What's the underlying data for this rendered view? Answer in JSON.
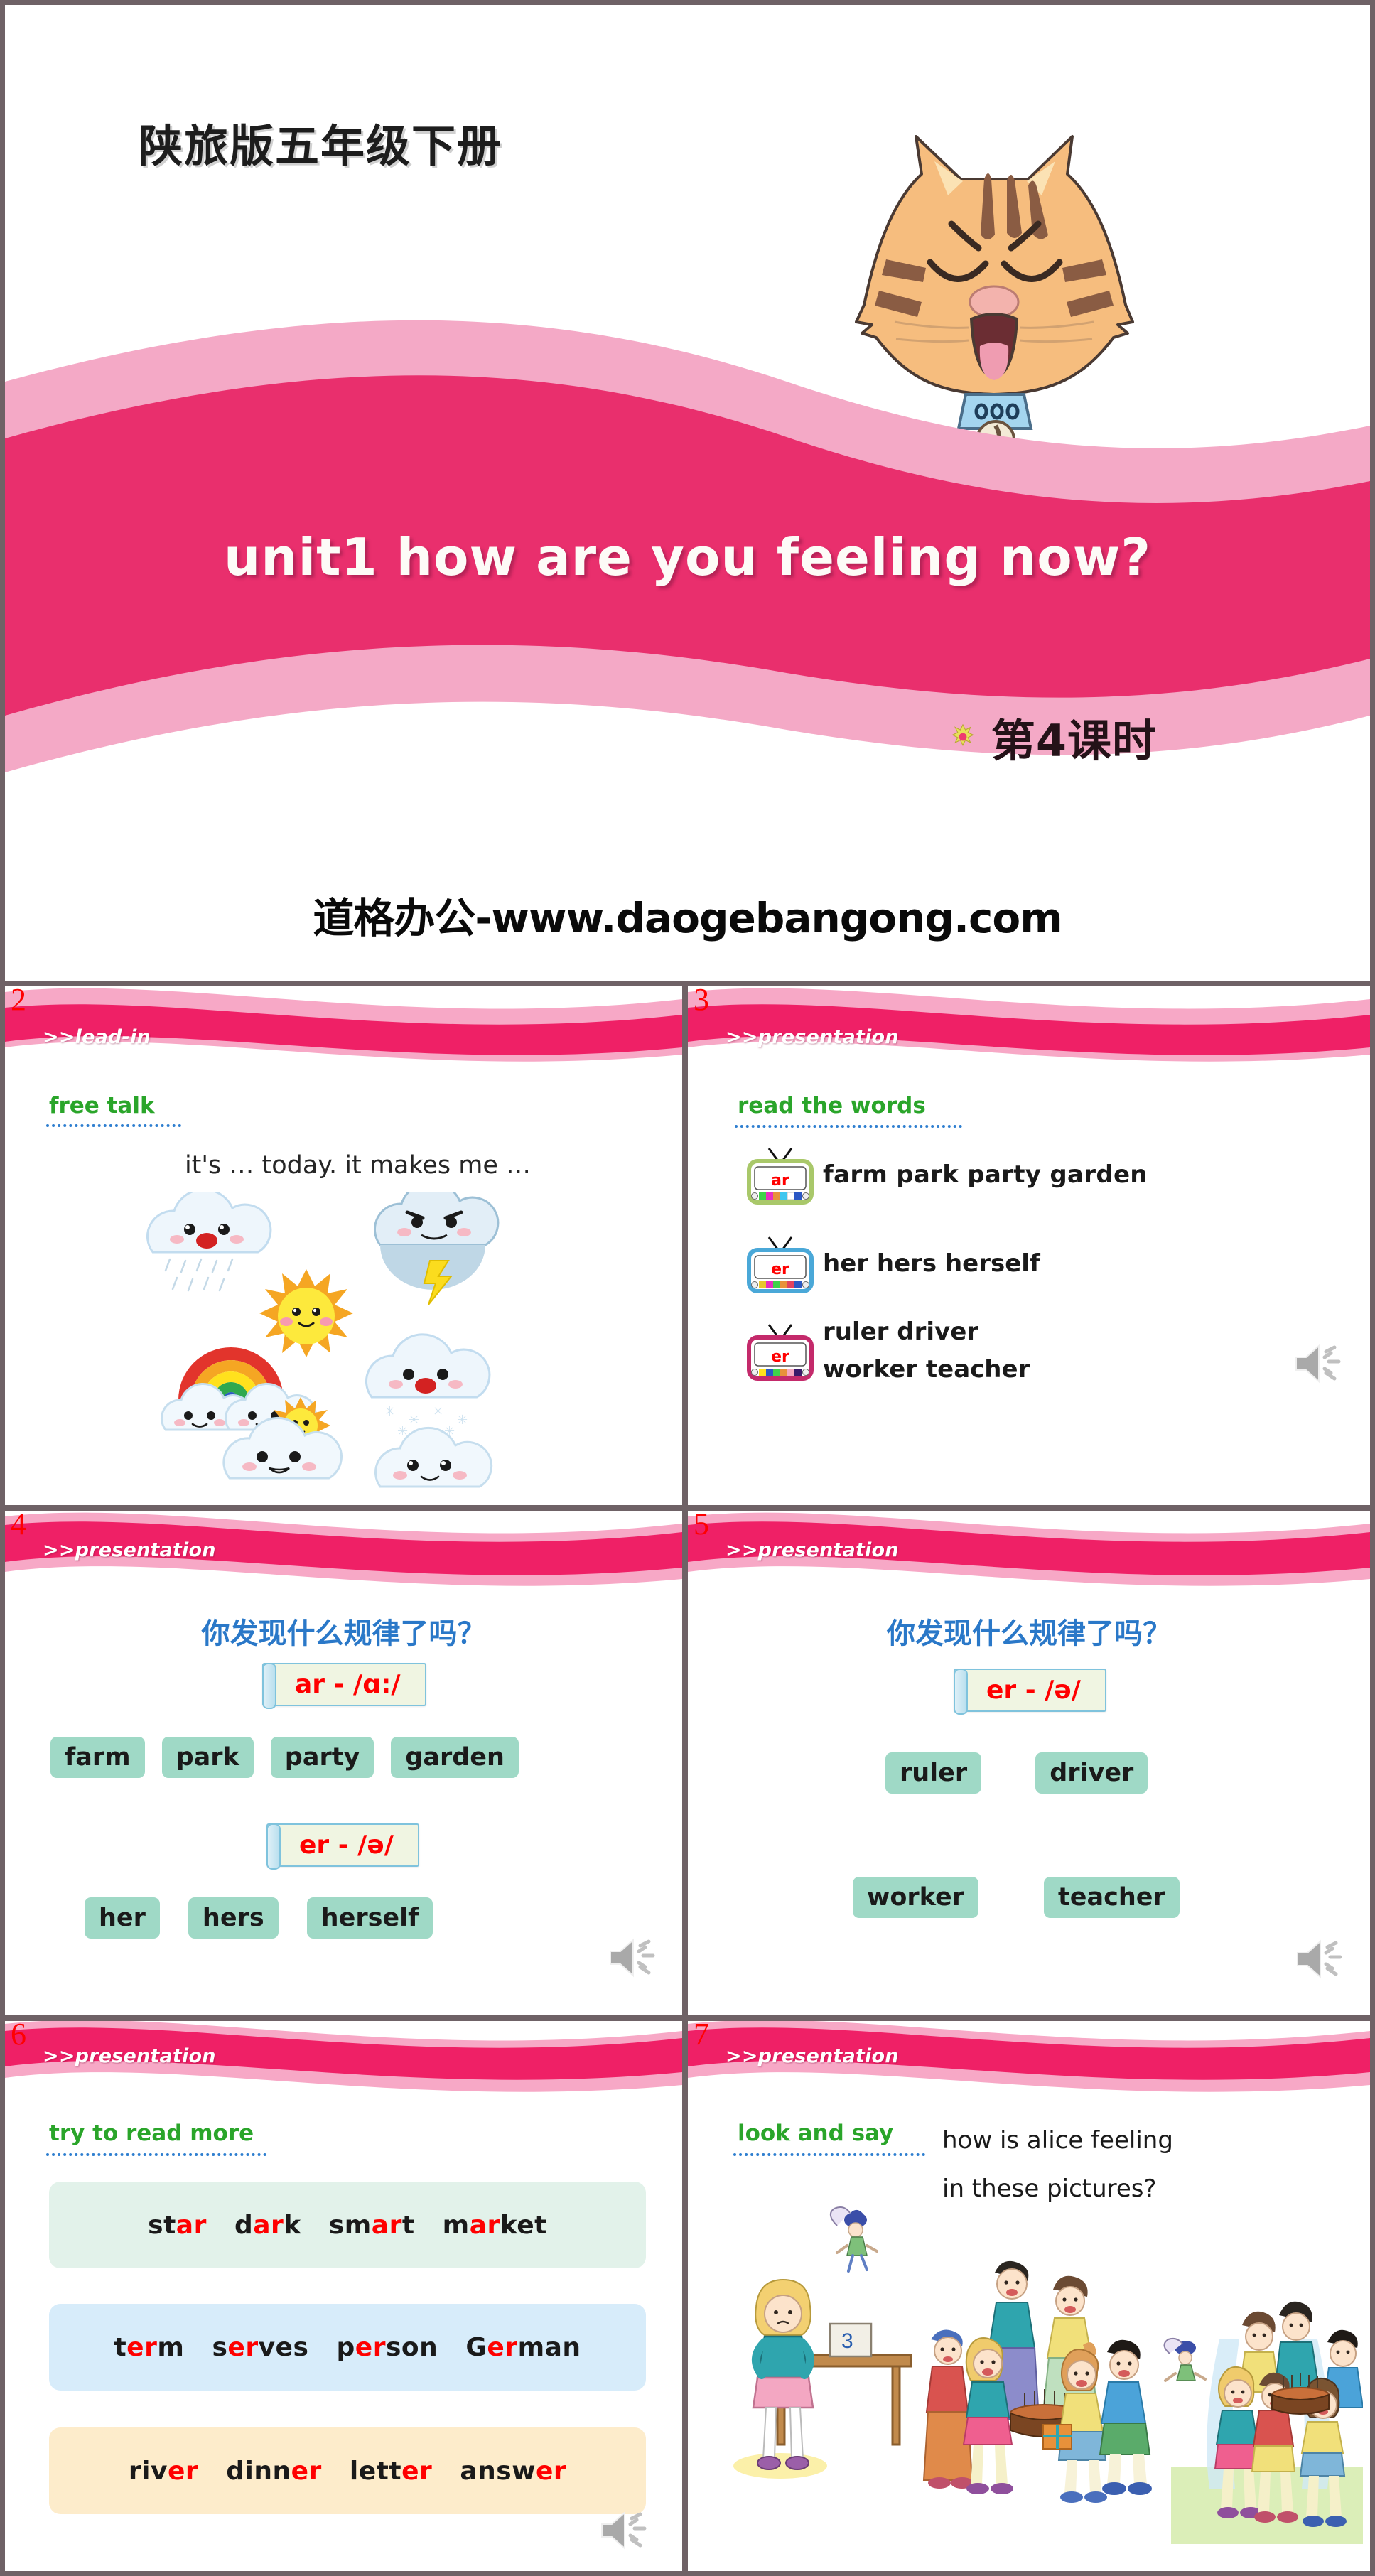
{
  "title_slide": {
    "textbook_line": "陕旅版五年级下册",
    "main_title": "unit1 how are you feeling now?",
    "lesson_label": "第4课时",
    "sun_icon": "sun-icon",
    "cat_icon": "smiling-cat-face",
    "watermark": "道格办公-www.daogebangong.com"
  },
  "slides": [
    {
      "number": "2",
      "ribbon_label": ">>lead-in",
      "section_head": "free talk",
      "prompt": "it's … today. it makes me …",
      "artwork": "weather-emoji-collection"
    },
    {
      "number": "3",
      "ribbon_label": ">>presentation",
      "section_head": "read the words",
      "rows": [
        {
          "tv_label": "ar",
          "tv_color": "#a9c86a",
          "words": "farm  park  party   garden"
        },
        {
          "tv_label": "er",
          "tv_color": "#4aa8d8",
          "words": "her     hers    herself"
        },
        {
          "tv_label": "er",
          "tv_color": "#c42a6b",
          "words_line1": "ruler              driver",
          "words_line2": "worker         teacher"
        }
      ],
      "speaker_icon": "speaker-icon"
    },
    {
      "number": "4",
      "ribbon_label": ">>presentation",
      "question": "你发现什么规律了吗？",
      "tag1": "ar - /ɑ:/",
      "group1": [
        "farm",
        "park",
        "party",
        "garden"
      ],
      "tag2": "er - /ə/",
      "group2": [
        "her",
        "hers",
        "herself"
      ],
      "speaker_icon": "speaker-icon"
    },
    {
      "number": "5",
      "ribbon_label": ">>presentation",
      "question": "你发现什么规律了吗？",
      "tag1": "er - /ə/",
      "group1": [
        "ruler",
        "driver"
      ],
      "group2": [
        "worker",
        "teacher"
      ],
      "speaker_icon": "speaker-icon"
    },
    {
      "number": "6",
      "ribbon_label": ">>presentation",
      "section_head": "try to read more",
      "bands": [
        {
          "color": "#e2f2ea",
          "words": [
            {
              "pre": "st",
              "hl": "ar",
              "post": ""
            },
            {
              "pre": "d",
              "hl": "ar",
              "post": "k"
            },
            {
              "pre": "sm",
              "hl": "ar",
              "post": "t"
            },
            {
              "pre": "m",
              "hl": "ar",
              "post": "ket"
            }
          ]
        },
        {
          "color": "#d7ecfa",
          "words": [
            {
              "pre": "t",
              "hl": "er",
              "post": "m"
            },
            {
              "pre": "s",
              "hl": "er",
              "post": "ves"
            },
            {
              "pre": "p",
              "hl": "er",
              "post": "son"
            },
            {
              "pre": "G",
              "hl": "er",
              "post": "man"
            }
          ]
        },
        {
          "color": "#fdeccb",
          "words": [
            {
              "pre": "riv",
              "hl": "er",
              "post": ""
            },
            {
              "pre": "dinn",
              "hl": "er",
              "post": ""
            },
            {
              "pre": "lett",
              "hl": "er",
              "post": ""
            },
            {
              "pre": "answ",
              "hl": "er",
              "post": ""
            }
          ]
        }
      ],
      "speaker_icon": "speaker-icon"
    },
    {
      "number": "7",
      "ribbon_label": ">>presentation",
      "section_head": "look and say",
      "ask_line1": "how is alice feeling",
      "ask_line2": "in these pictures?",
      "artwork": "alice-birthday-party-illustrations"
    }
  ],
  "colors": {
    "ribbon_deep_pink": "#ef2d6d",
    "ribbon_light_pink": "#f9a8c4",
    "accent_green": "#2aa52a",
    "accent_red": "#ff0000",
    "accent_blue": "#2a78c8",
    "chip_teal": "#9fd9c6",
    "page_border": "#6f6266"
  }
}
